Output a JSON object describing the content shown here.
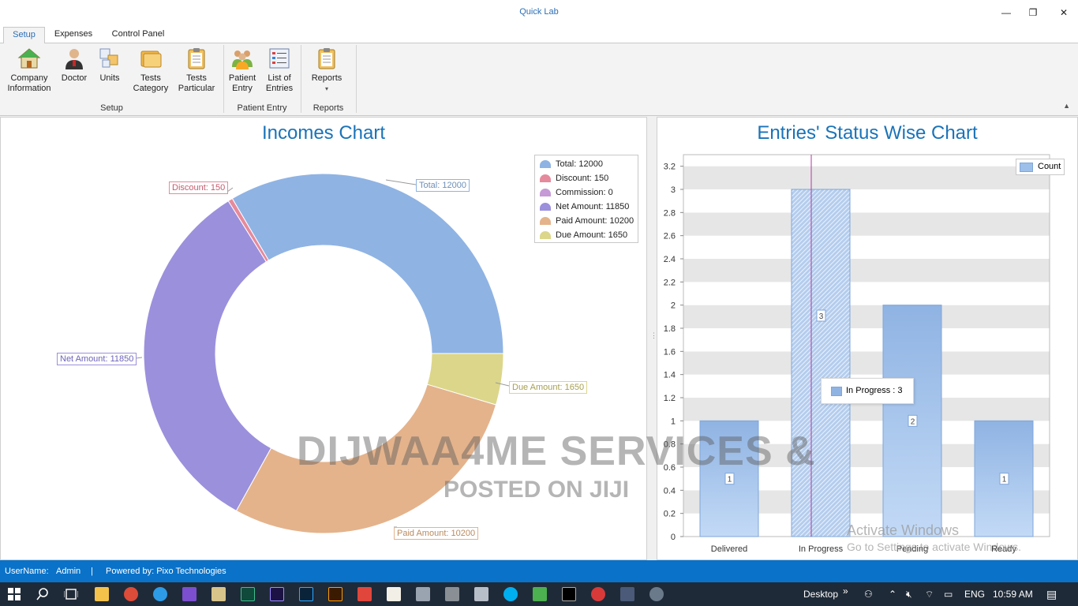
{
  "window": {
    "title": "Quick Lab",
    "min": "—",
    "restore": "❐",
    "close": "✕"
  },
  "tabs": [
    {
      "label": "Setup"
    },
    {
      "label": "Expenses"
    },
    {
      "label": "Control Panel"
    }
  ],
  "ribbon": {
    "buttons": [
      {
        "line1": "Company",
        "line2": "Information"
      },
      {
        "line1": "Doctor",
        "line2": ""
      },
      {
        "line1": "Units",
        "line2": ""
      },
      {
        "line1": "Tests",
        "line2": "Category"
      },
      {
        "line1": "Tests",
        "line2": "Particular"
      },
      {
        "line1": "Patient",
        "line2": "Entry"
      },
      {
        "line1": "List of",
        "line2": "Entries"
      },
      {
        "line1": "Reports",
        "line2": "▾"
      }
    ],
    "groups": [
      {
        "label": "Setup"
      },
      {
        "label": "Patient Entry"
      },
      {
        "label": "Reports"
      }
    ],
    "collapse": "▲"
  },
  "incomes_chart": {
    "title": "Incomes Chart"
  },
  "status_chart": {
    "title": "Entries' Status Wise Chart",
    "legend": "Count",
    "tooltip": "In Progress : 3"
  },
  "chart_data": [
    {
      "type": "pie",
      "title": "Incomes Chart",
      "labels": [
        "Total",
        "Discount",
        "Commission",
        "Net Amount",
        "Paid Amount",
        "Due Amount"
      ],
      "values": [
        12000,
        150,
        0,
        11850,
        10200,
        1650
      ],
      "legend_entries": [
        "Total: 12000",
        "Discount: 150",
        "Commission: 0",
        "Net Amount: 11850",
        "Paid Amount: 10200",
        "Due Amount: 1650"
      ],
      "point_labels": [
        "Total: 12000",
        "Discount: 150",
        "Net Amount: 11850",
        "Paid Amount: 10200",
        "Due Amount: 1650"
      ],
      "colors": [
        "#8fb3e3",
        "#e58a9c",
        "#c59ad6",
        "#9b90dc",
        "#e4b38c",
        "#dcd68a"
      ],
      "legend_position": "top-right"
    },
    {
      "type": "bar",
      "title": "Entries' Status Wise Chart",
      "categories": [
        "Delivered",
        "In Progress",
        "Pending",
        "Ready"
      ],
      "series": [
        {
          "name": "Count",
          "values": [
            1,
            3,
            2,
            1
          ]
        }
      ],
      "ylim": [
        0,
        3.3
      ],
      "yticks": [
        "0",
        "0.2",
        "0.4",
        "0.6",
        "0.8",
        "1",
        "1.2",
        "1.4",
        "1.6",
        "1.8",
        "2",
        "2.2",
        "2.4",
        "2.6",
        "2.8",
        "3",
        "3.2"
      ],
      "grid": true,
      "legend_position": "top-right"
    }
  ],
  "watermark": {
    "line1": "DIJWAA4ME SERVICES &",
    "line2": "POSTED ON JIJI"
  },
  "activation": {
    "line1": "Activate Windows",
    "line2": "Go to Settings to activate Windows."
  },
  "statusbar": {
    "user_label": "UserName:",
    "user": "Admin",
    "sep": "|",
    "powered": "Powered by: Pixo Technologies"
  },
  "taskbar": {
    "desktop": "Desktop",
    "chevron": "»",
    "lang": "ENG",
    "time": "10:59 AM"
  }
}
